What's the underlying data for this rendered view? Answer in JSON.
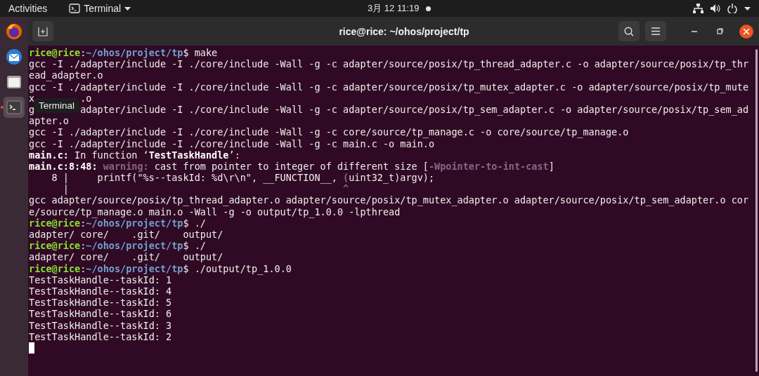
{
  "top_bar": {
    "activities": "Activities",
    "app_menu": "Terminal",
    "clock": "3月 12 11:19"
  },
  "dock": {
    "items": [
      {
        "kind": "browser",
        "selected": false
      },
      {
        "kind": "mail",
        "selected": false
      },
      {
        "kind": "files",
        "selected": false
      },
      {
        "kind": "terminal",
        "selected": true
      }
    ]
  },
  "tooltip": "Terminal",
  "window": {
    "title": "rice@rice: ~/ohos/project/tp"
  },
  "terminal": {
    "lines": [
      [
        {
          "text": "rice@rice",
          "kind": "user"
        },
        {
          "text": ":",
          "kind": "plain"
        },
        {
          "text": "~/ohos/project/tp",
          "kind": "path"
        },
        {
          "text": "$ make",
          "kind": "plain"
        }
      ],
      [
        {
          "text": "gcc -I ./adapter/include -I ./core/include -Wall -g -c adapter/source/posix/tp_thread_adapter.c -o adapter/source/posix/tp_thr",
          "kind": "plain"
        }
      ],
      [
        {
          "text": "ead_adapter.o",
          "kind": "plain"
        }
      ],
      [
        {
          "text": "gcc -I ./adapter/include -I ./core/include -Wall -g -c adapter/source/posix/tp_mutex_adapter.c -o adapter/source/posix/tp_mute",
          "kind": "plain"
        }
      ],
      [
        {
          "text": "x",
          "kind": "plain"
        },
        {
          "text": ".o",
          "kind": "plain",
          "covered_before": true
        }
      ],
      [
        {
          "text": "g",
          "kind": "plain"
        },
        {
          "text": "adapter/include -I ./core/include -Wall -g -c adapter/source/posix/tp_sem_adapter.c -o adapter/source/posix/tp_sem_ad",
          "kind": "plain",
          "covered_before": true
        }
      ],
      [
        {
          "text": "apter.o",
          "kind": "plain"
        }
      ],
      [
        {
          "text": "gcc -I ./adapter/include -I ./core/include -Wall -g -c core/source/tp_manage.c -o core/source/tp_manage.o",
          "kind": "plain"
        }
      ],
      [
        {
          "text": "gcc -I ./adapter/include -I ./core/include -Wall -g -c main.c -o main.o",
          "kind": "plain"
        }
      ],
      [
        {
          "text": "main.c:",
          "kind": "bold"
        },
        {
          "text": " In function ‘",
          "kind": "plain"
        },
        {
          "text": "TestTaskHandle",
          "kind": "bold"
        },
        {
          "text": "’:",
          "kind": "plain"
        }
      ],
      [
        {
          "text": "main.c:8:48: ",
          "kind": "bold"
        },
        {
          "text": "warning:",
          "kind": "warning"
        },
        {
          "text": " cast from pointer to integer of different size [",
          "kind": "plain"
        },
        {
          "text": "-Wpointer-to-int-cast",
          "kind": "warning"
        },
        {
          "text": "]",
          "kind": "plain"
        }
      ],
      [
        {
          "text": "    8 |     printf(\"%s--taskId: %d\\r\\n\", __FUNCTION__, ",
          "kind": "plain"
        },
        {
          "text": "(",
          "kind": "warning"
        },
        {
          "text": "uint32_t)argv);",
          "kind": "plain"
        }
      ],
      [
        {
          "text": "      |                                                ",
          "kind": "plain"
        },
        {
          "text": "^",
          "kind": "warning"
        }
      ],
      [
        {
          "text": "gcc adapter/source/posix/tp_thread_adapter.o adapter/source/posix/tp_mutex_adapter.o adapter/source/posix/tp_sem_adapter.o cor",
          "kind": "plain"
        }
      ],
      [
        {
          "text": "e/source/tp_manage.o main.o -Wall -g -o output/tp_1.0.0 -lpthread",
          "kind": "plain"
        }
      ],
      [
        {
          "text": "rice@rice",
          "kind": "user"
        },
        {
          "text": ":",
          "kind": "plain"
        },
        {
          "text": "~/ohos/project/tp",
          "kind": "path"
        },
        {
          "text": "$ ./",
          "kind": "plain"
        }
      ],
      [
        {
          "text": "adapter/ core/    .git/    output/",
          "kind": "plain"
        }
      ],
      [
        {
          "text": "rice@rice",
          "kind": "user"
        },
        {
          "text": ":",
          "kind": "plain"
        },
        {
          "text": "~/ohos/project/tp",
          "kind": "path"
        },
        {
          "text": "$ ./",
          "kind": "plain"
        }
      ],
      [
        {
          "text": "adapter/ core/    .git/    output/",
          "kind": "plain"
        }
      ],
      [
        {
          "text": "rice@rice",
          "kind": "user"
        },
        {
          "text": ":",
          "kind": "plain"
        },
        {
          "text": "~/ohos/project/tp",
          "kind": "path"
        },
        {
          "text": "$ ./output/tp_1.0.0",
          "kind": "plain"
        }
      ],
      [
        {
          "text": "TestTaskHandle--taskId: 1",
          "kind": "plain"
        }
      ],
      [
        {
          "text": "TestTaskHandle--taskId: 4",
          "kind": "plain"
        }
      ],
      [
        {
          "text": "TestTaskHandle--taskId: 5",
          "kind": "plain"
        }
      ],
      [
        {
          "text": "TestTaskHandle--taskId: 6",
          "kind": "plain"
        }
      ],
      [
        {
          "text": "TestTaskHandle--taskId: 3",
          "kind": "plain"
        }
      ],
      [
        {
          "text": "TestTaskHandle--taskId: 2",
          "kind": "plain"
        }
      ]
    ]
  }
}
